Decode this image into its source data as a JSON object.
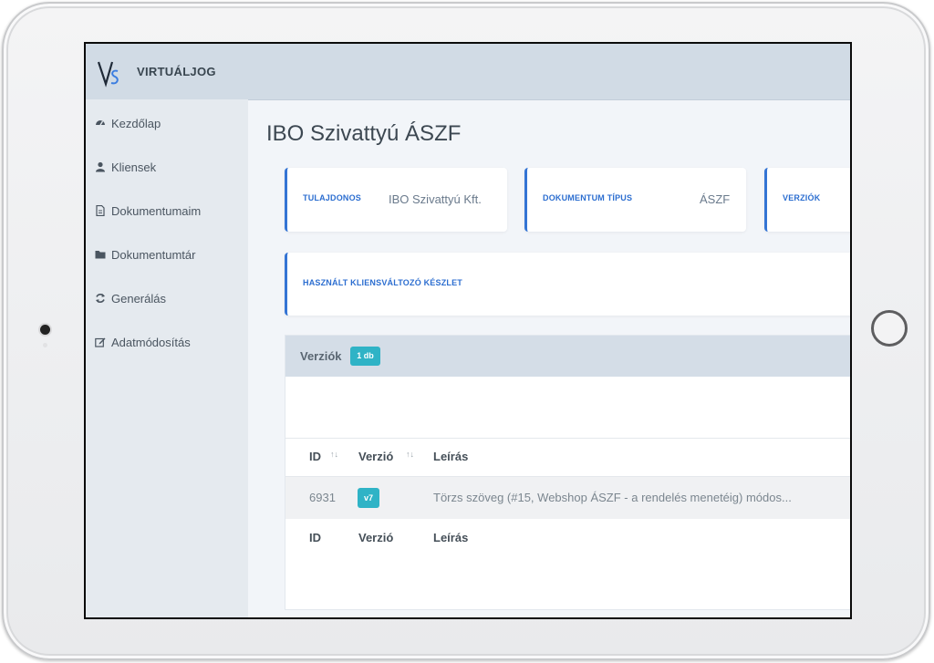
{
  "app": {
    "brand": "VIRTUÁLJOG",
    "logo_letters": "VS"
  },
  "sidebar": {
    "items": [
      {
        "label": "Kezdőlap",
        "icon": "dashboard-icon"
      },
      {
        "label": "Kliensek",
        "icon": "user-icon"
      },
      {
        "label": "Dokumentumaim",
        "icon": "document-icon"
      },
      {
        "label": "Dokumentumtár",
        "icon": "folder-icon"
      },
      {
        "label": "Generálás",
        "icon": "refresh-icon"
      },
      {
        "label": "Adatmódosítás",
        "icon": "edit-icon"
      }
    ]
  },
  "page": {
    "title": "IBO Szivattyú ÁSZF"
  },
  "cards": {
    "owner_label": "TULAJDONOS",
    "owner_value": "IBO Szivattyú Kft.",
    "doctype_label": "DOKUMENTUM TÍPUS",
    "doctype_value": "ÁSZF",
    "versions_label": "VERZIÓK",
    "client_vars_label": "HASZNÁLT KLIENSVÁLTOZÓ KÉSZLET"
  },
  "versions_panel": {
    "title": "Verziók",
    "count_badge": "1 db",
    "columns": [
      "ID",
      "Verzió",
      "Leírás"
    ],
    "rows": [
      {
        "id": "6931",
        "version": "v7",
        "description": "Törzs szöveg (#15, Webshop ÁSZF - a rendelés menetéig) módos..."
      }
    ],
    "footer_columns": [
      "ID",
      "Verzió",
      "Leírás"
    ]
  },
  "colors": {
    "accent_blue": "#3474d4",
    "badge_teal": "#2fb3c6",
    "topbar": "#d1dbe5",
    "sidebar": "#e5eaef"
  }
}
